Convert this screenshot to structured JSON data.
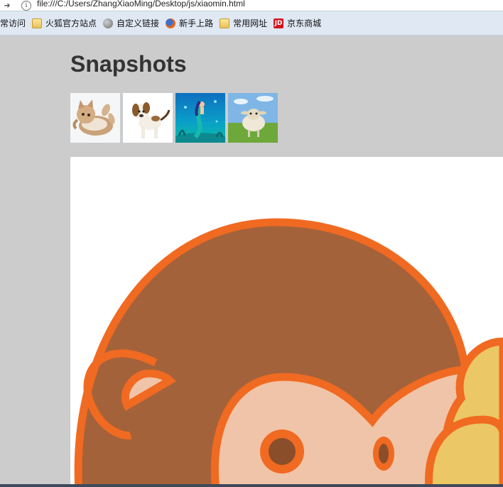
{
  "browser": {
    "url": "file:///C:/Users/ZhangXiaoMing/Desktop/js/xiaomin.html",
    "bookmarks": [
      {
        "label": "常访问",
        "icon": "none"
      },
      {
        "label": "火狐官方站点",
        "icon": "folder-icon"
      },
      {
        "label": "自定义链接",
        "icon": "globe-icon"
      },
      {
        "label": "新手上路",
        "icon": "firefox-icon"
      },
      {
        "label": "常用网址",
        "icon": "folder-icon"
      },
      {
        "label": "京东商城",
        "icon": "jd-icon"
      }
    ],
    "jd_icon_text": "JD"
  },
  "page": {
    "title": "Snapshots",
    "thumbnails": [
      {
        "subject": "kitten"
      },
      {
        "subject": "puppy"
      },
      {
        "subject": "mermaid"
      },
      {
        "subject": "sheep"
      }
    ]
  },
  "colors": {
    "background": "#cccccc",
    "title": "#333333",
    "monkey_fur": "#a4623a",
    "monkey_outline": "#f06a22",
    "monkey_face": "#f0c4a8"
  }
}
